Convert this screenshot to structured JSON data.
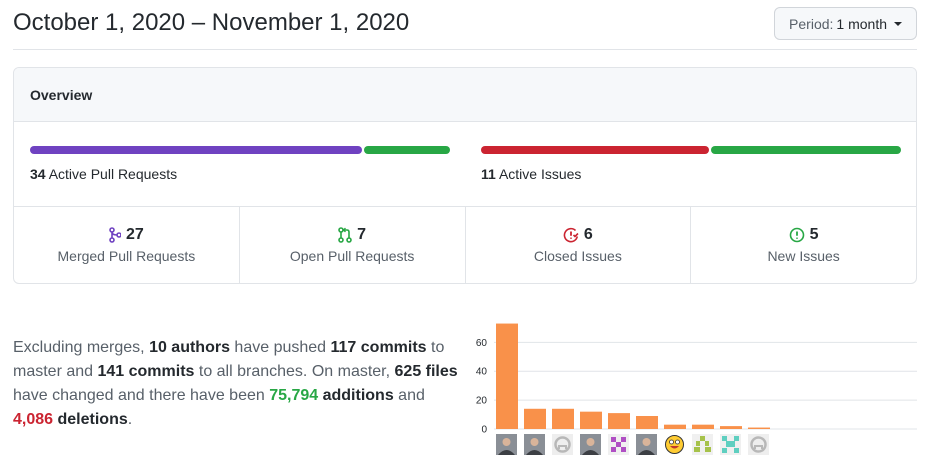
{
  "header": {
    "title": "October 1, 2020 – November 1, 2020",
    "period_label": "Period:",
    "period_value": "1 month"
  },
  "overview": {
    "title": "Overview",
    "pull_requests": {
      "count": "34",
      "label": "Active Pull Requests",
      "merged_share": 0.794,
      "open_share": 0.206,
      "merged_color": "#6f42c1",
      "open_color": "#28a745"
    },
    "issues": {
      "count": "11",
      "label": "Active Issues",
      "closed_share": 0.545,
      "new_share": 0.455,
      "closed_color": "#cb2431",
      "new_color": "#28a745"
    },
    "stats": [
      {
        "icon": "merge-icon",
        "count": "27",
        "label": "Merged Pull Requests",
        "color": "#6f42c1"
      },
      {
        "icon": "pull-request-icon",
        "count": "7",
        "label": "Open Pull Requests",
        "color": "#28a745"
      },
      {
        "icon": "issue-closed-icon",
        "count": "6",
        "label": "Closed Issues",
        "color": "#cb2431"
      },
      {
        "icon": "issue-opened-icon",
        "count": "5",
        "label": "New Issues",
        "color": "#28a745"
      }
    ]
  },
  "summary": {
    "t1": "Excluding merges, ",
    "authors": "10 authors",
    "t2": " have pushed ",
    "commits_master": "117 commits",
    "t3": " to master and ",
    "commits_all": "141 commits",
    "t4": " to all branches. On master, ",
    "files": "625 files",
    "t5": " have changed and there have been ",
    "additions_num": "75,794",
    "additions_word": "additions",
    "t6": " and ",
    "deletions_num": "4,086",
    "deletions_word": "deletions",
    "t7": "."
  },
  "chart_data": {
    "type": "bar",
    "title": "",
    "xlabel": "",
    "ylabel": "",
    "ylim": [
      0,
      72
    ],
    "yticks": [
      0,
      20,
      40,
      60
    ],
    "grid": true,
    "color": "#f9914a",
    "values": [
      73,
      14,
      14,
      12,
      11,
      9,
      3,
      3,
      2,
      1
    ],
    "avatars": [
      "photo-avatar",
      "photo-avatar",
      "github-default-avatar",
      "photo-avatar",
      "identicon-purple",
      "photo-avatar",
      "emoji-avatar",
      "identicon-green",
      "identicon-teal",
      "github-default-avatar"
    ]
  }
}
